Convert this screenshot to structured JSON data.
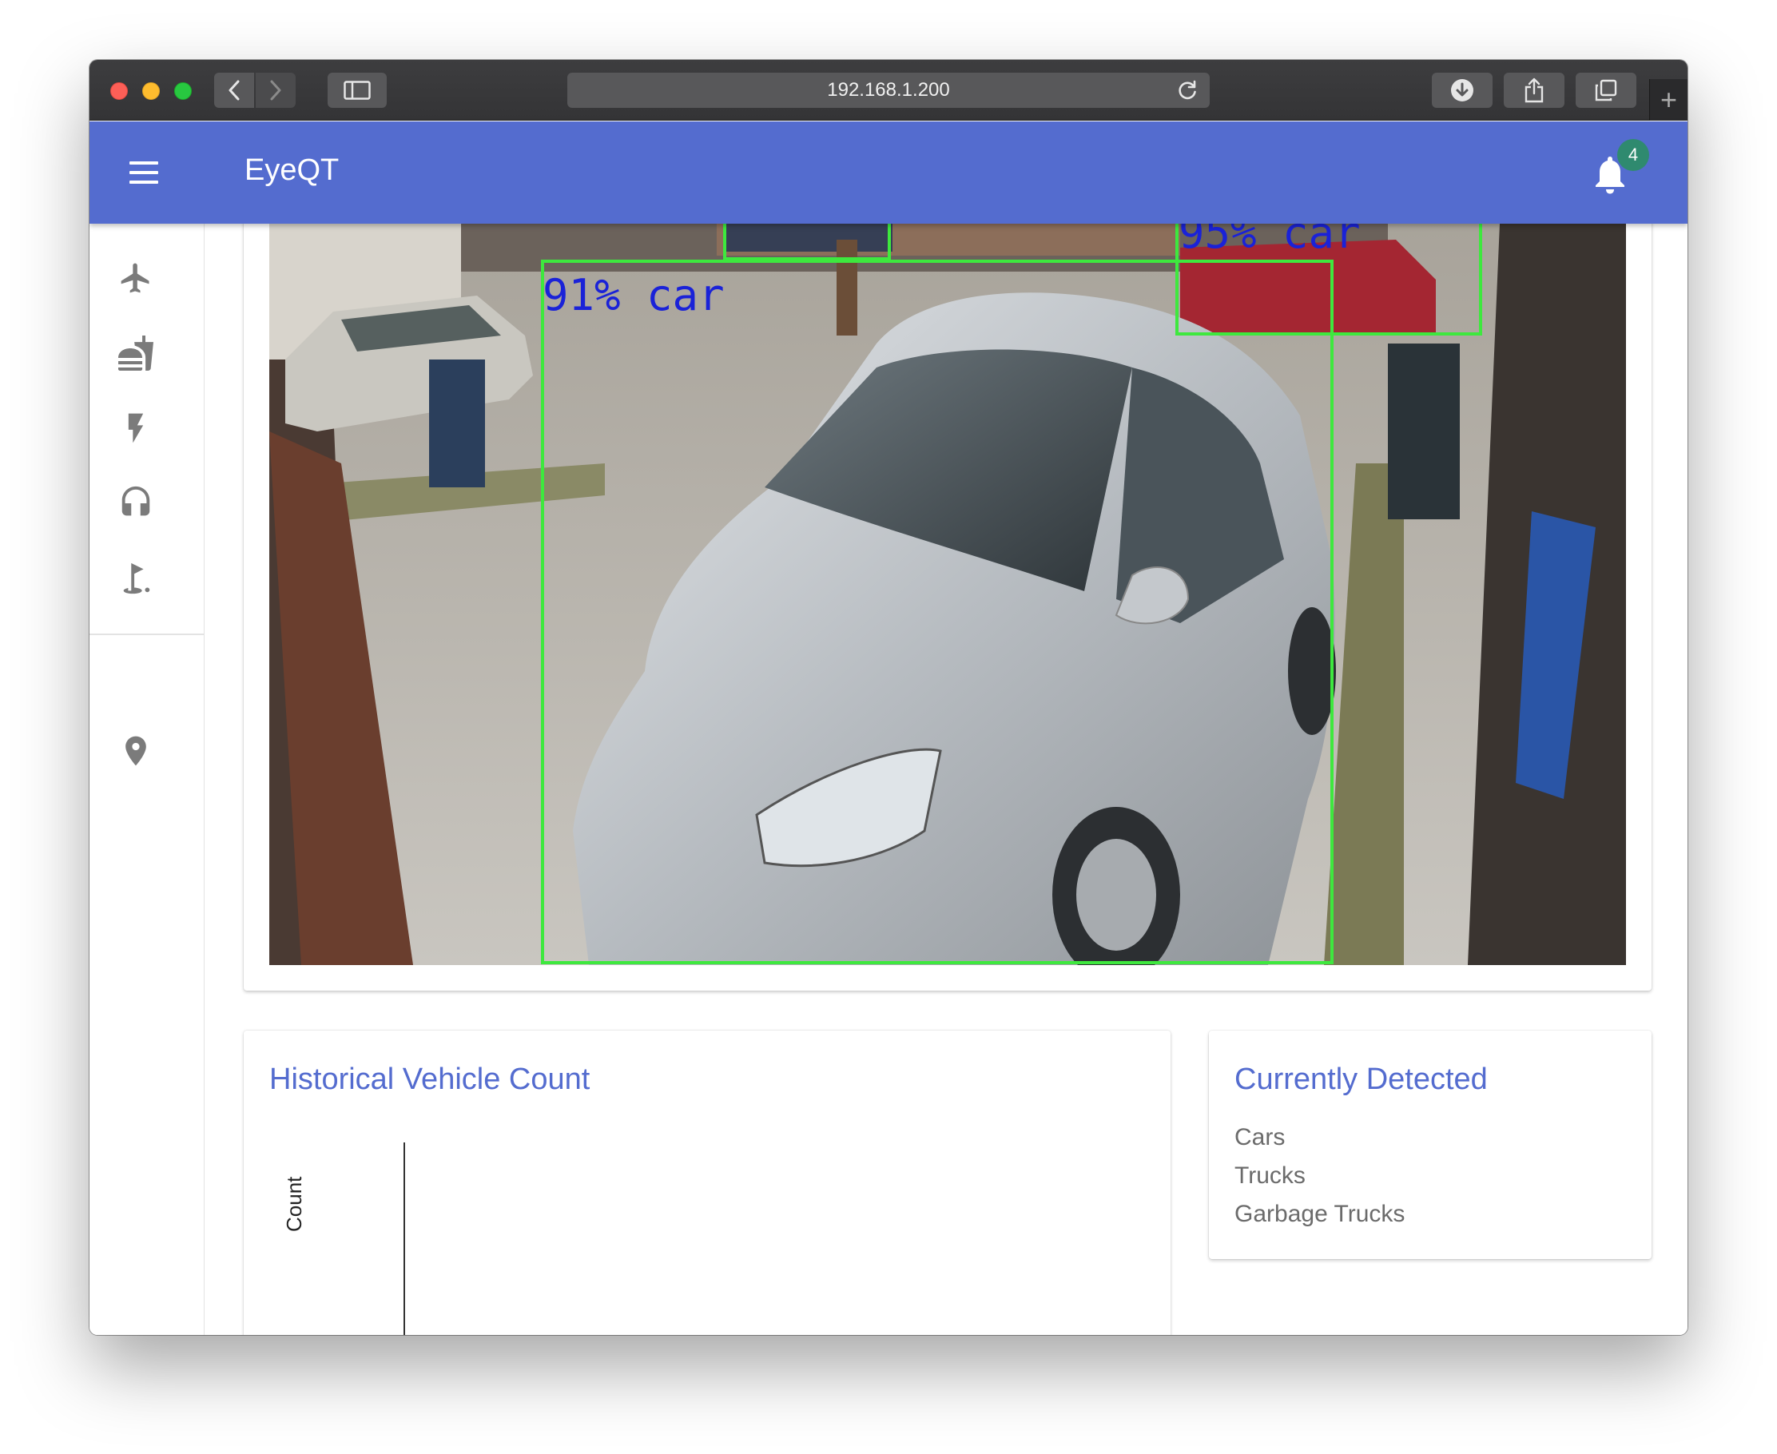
{
  "browser": {
    "url": "192.168.1.200",
    "new_tab": "+"
  },
  "app": {
    "title": "EyeQT",
    "notification_count": "4",
    "accent_color": "#546ccf"
  },
  "rail": {
    "items": [
      {
        "icon": "airplane-icon"
      },
      {
        "icon": "fastfood-icon"
      },
      {
        "icon": "flash-icon"
      },
      {
        "icon": "headset-icon"
      },
      {
        "icon": "golf-icon"
      },
      {
        "icon": "place-icon"
      }
    ]
  },
  "camera": {
    "detections": [
      {
        "label": "91% car"
      },
      {
        "label": "95% car"
      },
      {
        "label": ""
      }
    ],
    "box_color": "#3ee83e",
    "label_color": "#1a22d8"
  },
  "historical": {
    "title": "Historical Vehicle Count",
    "y_label": "Count"
  },
  "detected": {
    "title": "Currently Detected",
    "items": [
      "Cars",
      "Trucks",
      "Garbage Trucks"
    ]
  }
}
